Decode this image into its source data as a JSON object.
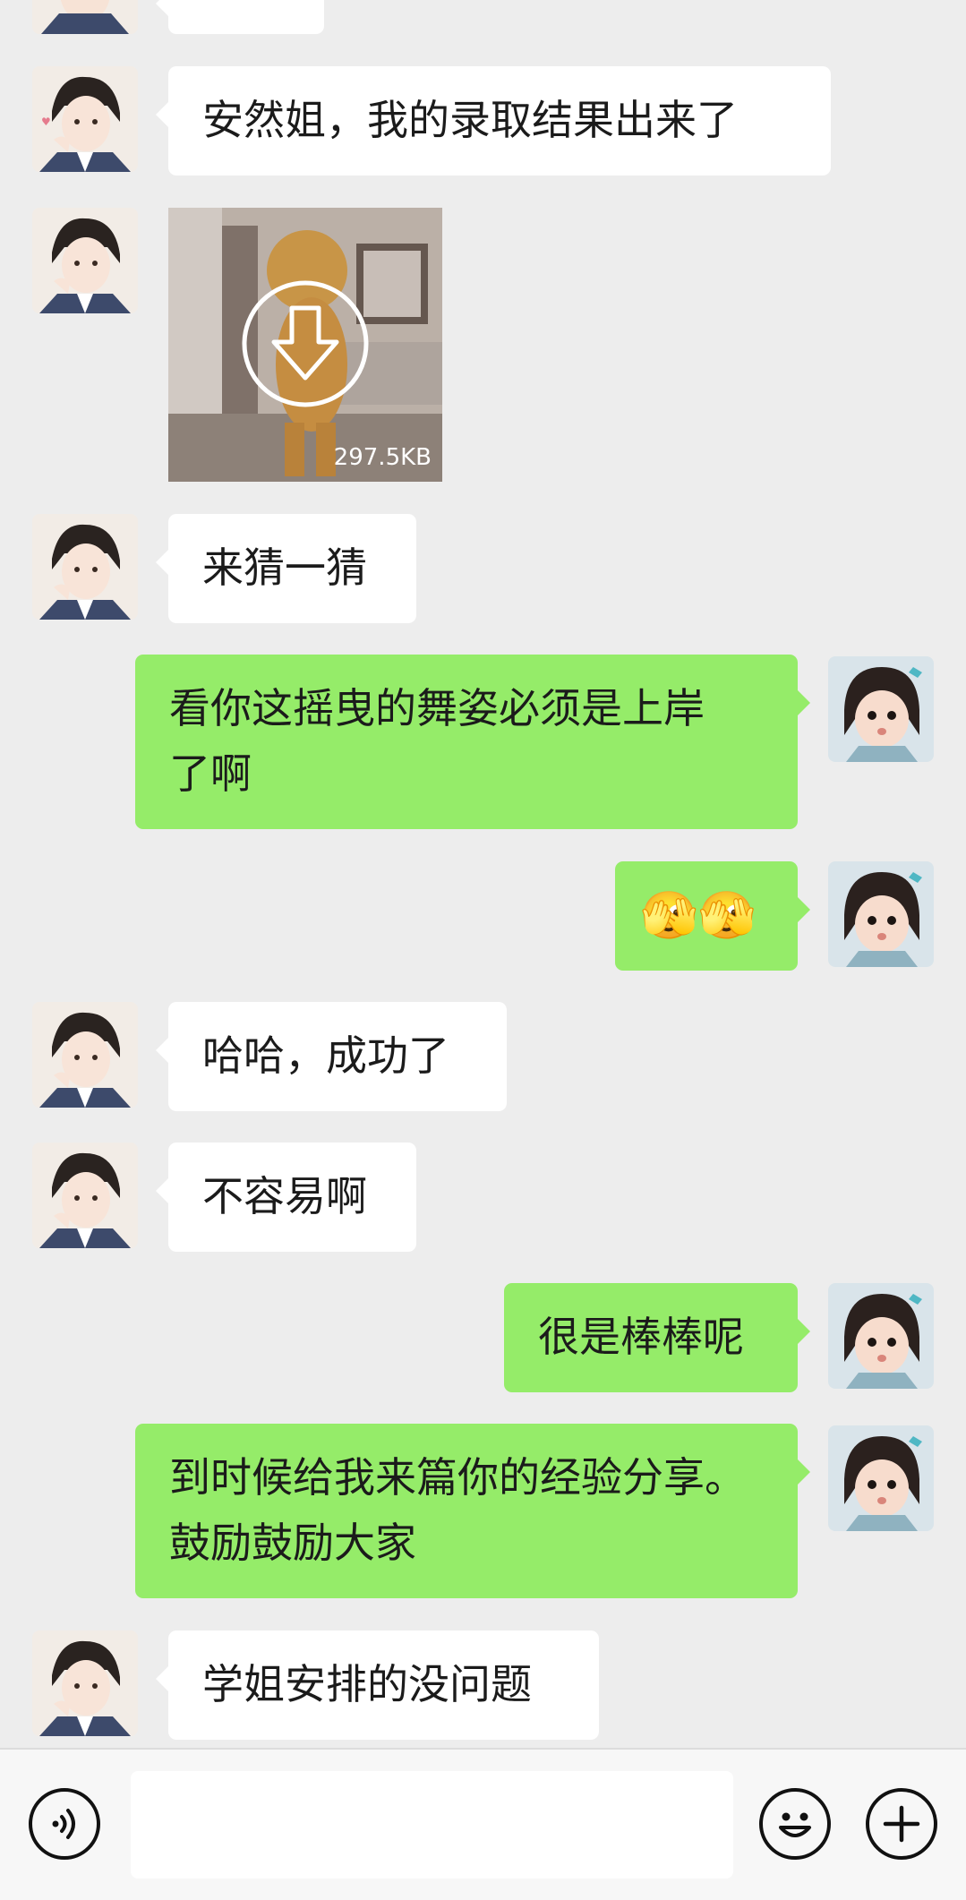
{
  "messages": [
    {
      "side": "in",
      "text": "安然姐，我的录取结果出来了"
    },
    {
      "side": "in",
      "type": "image",
      "size": "297.5KB"
    },
    {
      "side": "in",
      "text": "来猜一猜"
    },
    {
      "side": "out",
      "line1": "看你这摇曳的舞姿必须是上岸",
      "line2": "了啊"
    },
    {
      "side": "out",
      "type": "emoji",
      "emoji": "🫣🫣"
    },
    {
      "side": "in",
      "text": "哈哈，成功了"
    },
    {
      "side": "in",
      "text": "不容易啊"
    },
    {
      "side": "out",
      "text": "很是棒棒呢"
    },
    {
      "side": "out",
      "line1": "到时候给我来篇你的经验分享。",
      "line2": "鼓励鼓励大家"
    },
    {
      "side": "in",
      "text": "学姐安排的没问题"
    }
  ],
  "input": {
    "placeholder": ""
  },
  "icons": {
    "voice": "voice-icon",
    "emoji": "emoji-icon",
    "add": "add-icon"
  }
}
